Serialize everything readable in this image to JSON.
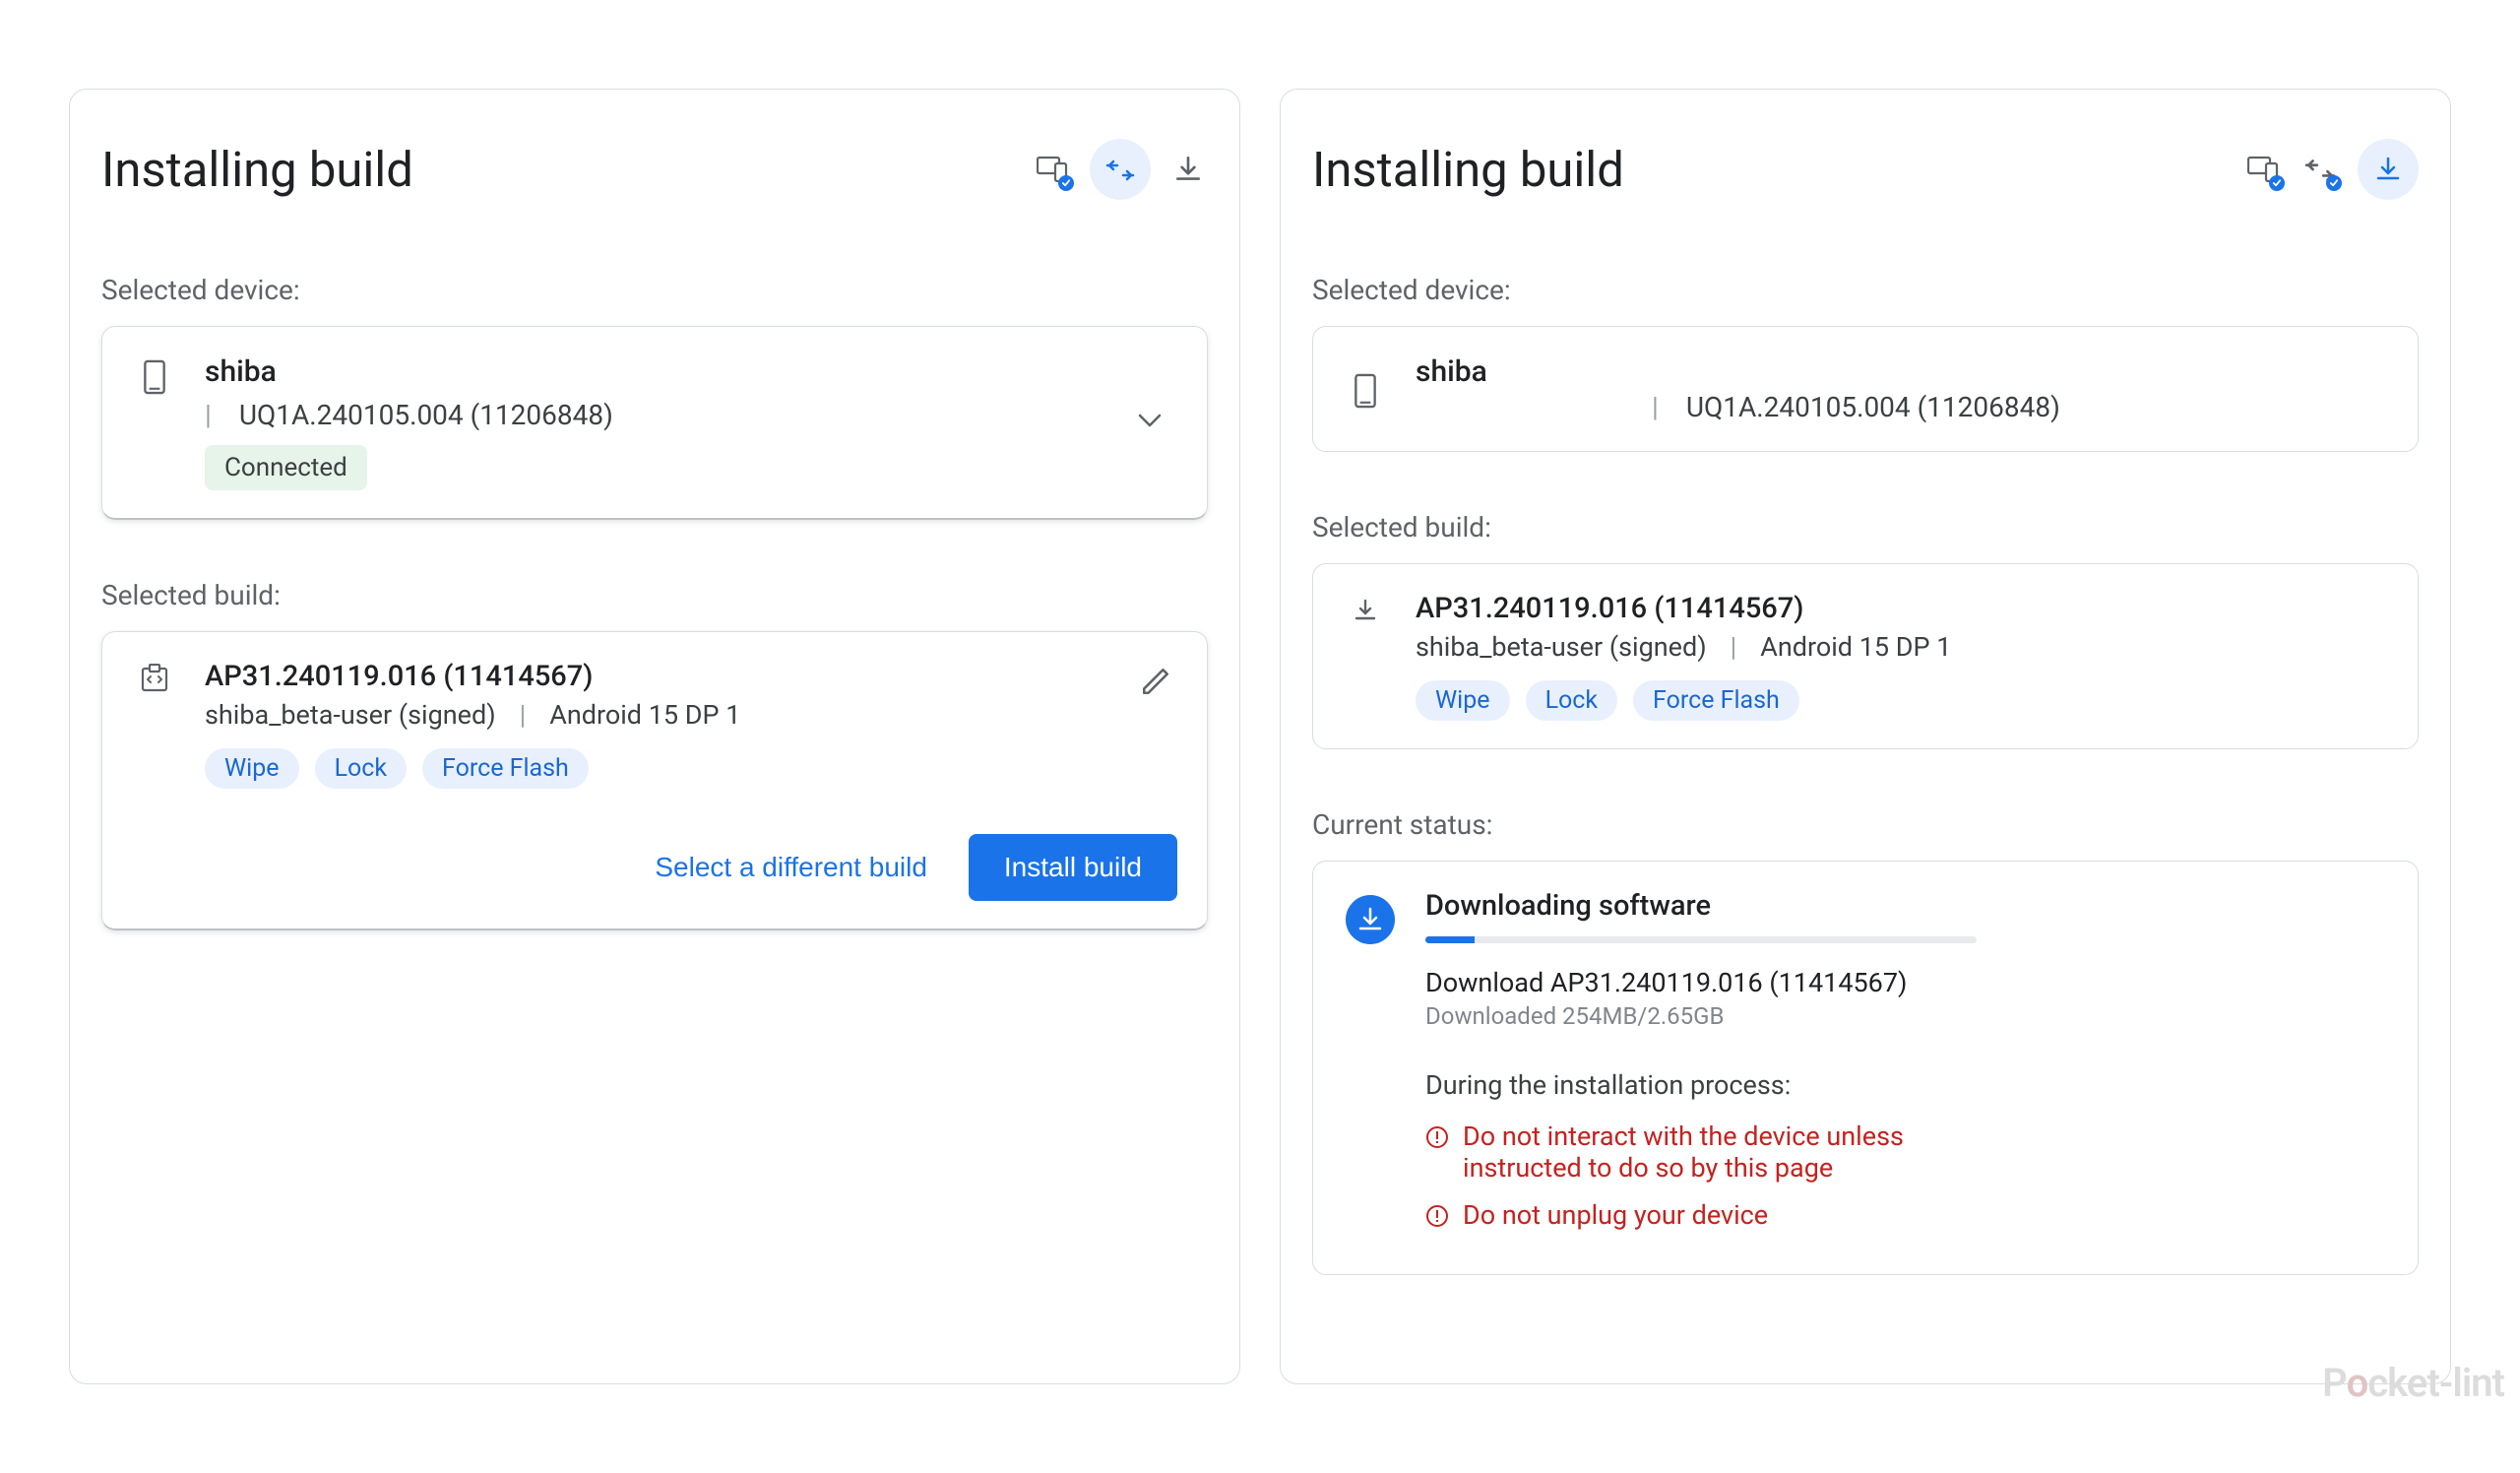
{
  "left": {
    "title": "Installing build",
    "selected_device_label": "Selected device:",
    "device": {
      "name": "shiba",
      "build_id": "UQ1A.240105.004 (11206848)",
      "status": "Connected"
    },
    "selected_build_label": "Selected build:",
    "build": {
      "id": "AP31.240119.016 (11414567)",
      "variant": "shiba_beta-user (signed)",
      "release": "Android 15 DP 1",
      "chips": [
        "Wipe",
        "Lock",
        "Force Flash"
      ]
    },
    "actions": {
      "select_different": "Select a different build",
      "install": "Install build"
    }
  },
  "right": {
    "title": "Installing build",
    "selected_device_label": "Selected device:",
    "device": {
      "name": "shiba",
      "build_id": "UQ1A.240105.004 (11206848)"
    },
    "selected_build_label": "Selected build:",
    "build": {
      "id": "AP31.240119.016 (11414567)",
      "variant": "shiba_beta-user (signed)",
      "release": "Android 15 DP 1",
      "chips": [
        "Wipe",
        "Lock",
        "Force Flash"
      ]
    },
    "status_label": "Current status:",
    "status": {
      "title": "Downloading software",
      "line": "Download AP31.240119.016 (11414567)",
      "sub": "Downloaded 254MB/2.65GB",
      "note": "During the installation process:",
      "warn1": "Do not interact with the device unless instructed to do so by this page",
      "warn2": "Do not unplug your device"
    }
  },
  "watermark": {
    "p1": "P",
    "o": "o",
    "p2": "cket-lint"
  }
}
